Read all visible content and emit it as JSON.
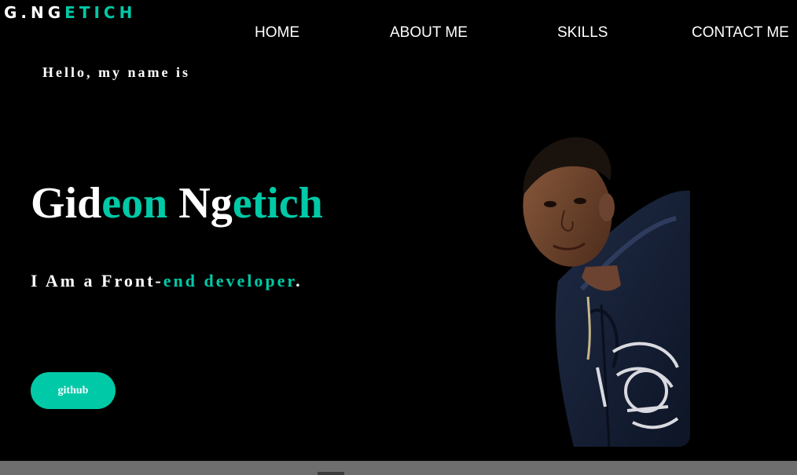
{
  "logo": {
    "part1": "G.NG",
    "part2": "ETICH"
  },
  "nav": {
    "home": "HOME",
    "about": "ABOUT ME",
    "skills": "SKILLS",
    "contact": "CONTACT ME"
  },
  "hero": {
    "greeting": "Hello, my name is",
    "name_parts": [
      "Gid",
      "eon ",
      "Ng",
      "etich"
    ],
    "role_parts": [
      "I Am a Front-",
      "end developer",
      "."
    ],
    "button_label": "github"
  },
  "colors": {
    "background": "#000000",
    "accent": "#00c9a7",
    "text": "#ffffff"
  }
}
